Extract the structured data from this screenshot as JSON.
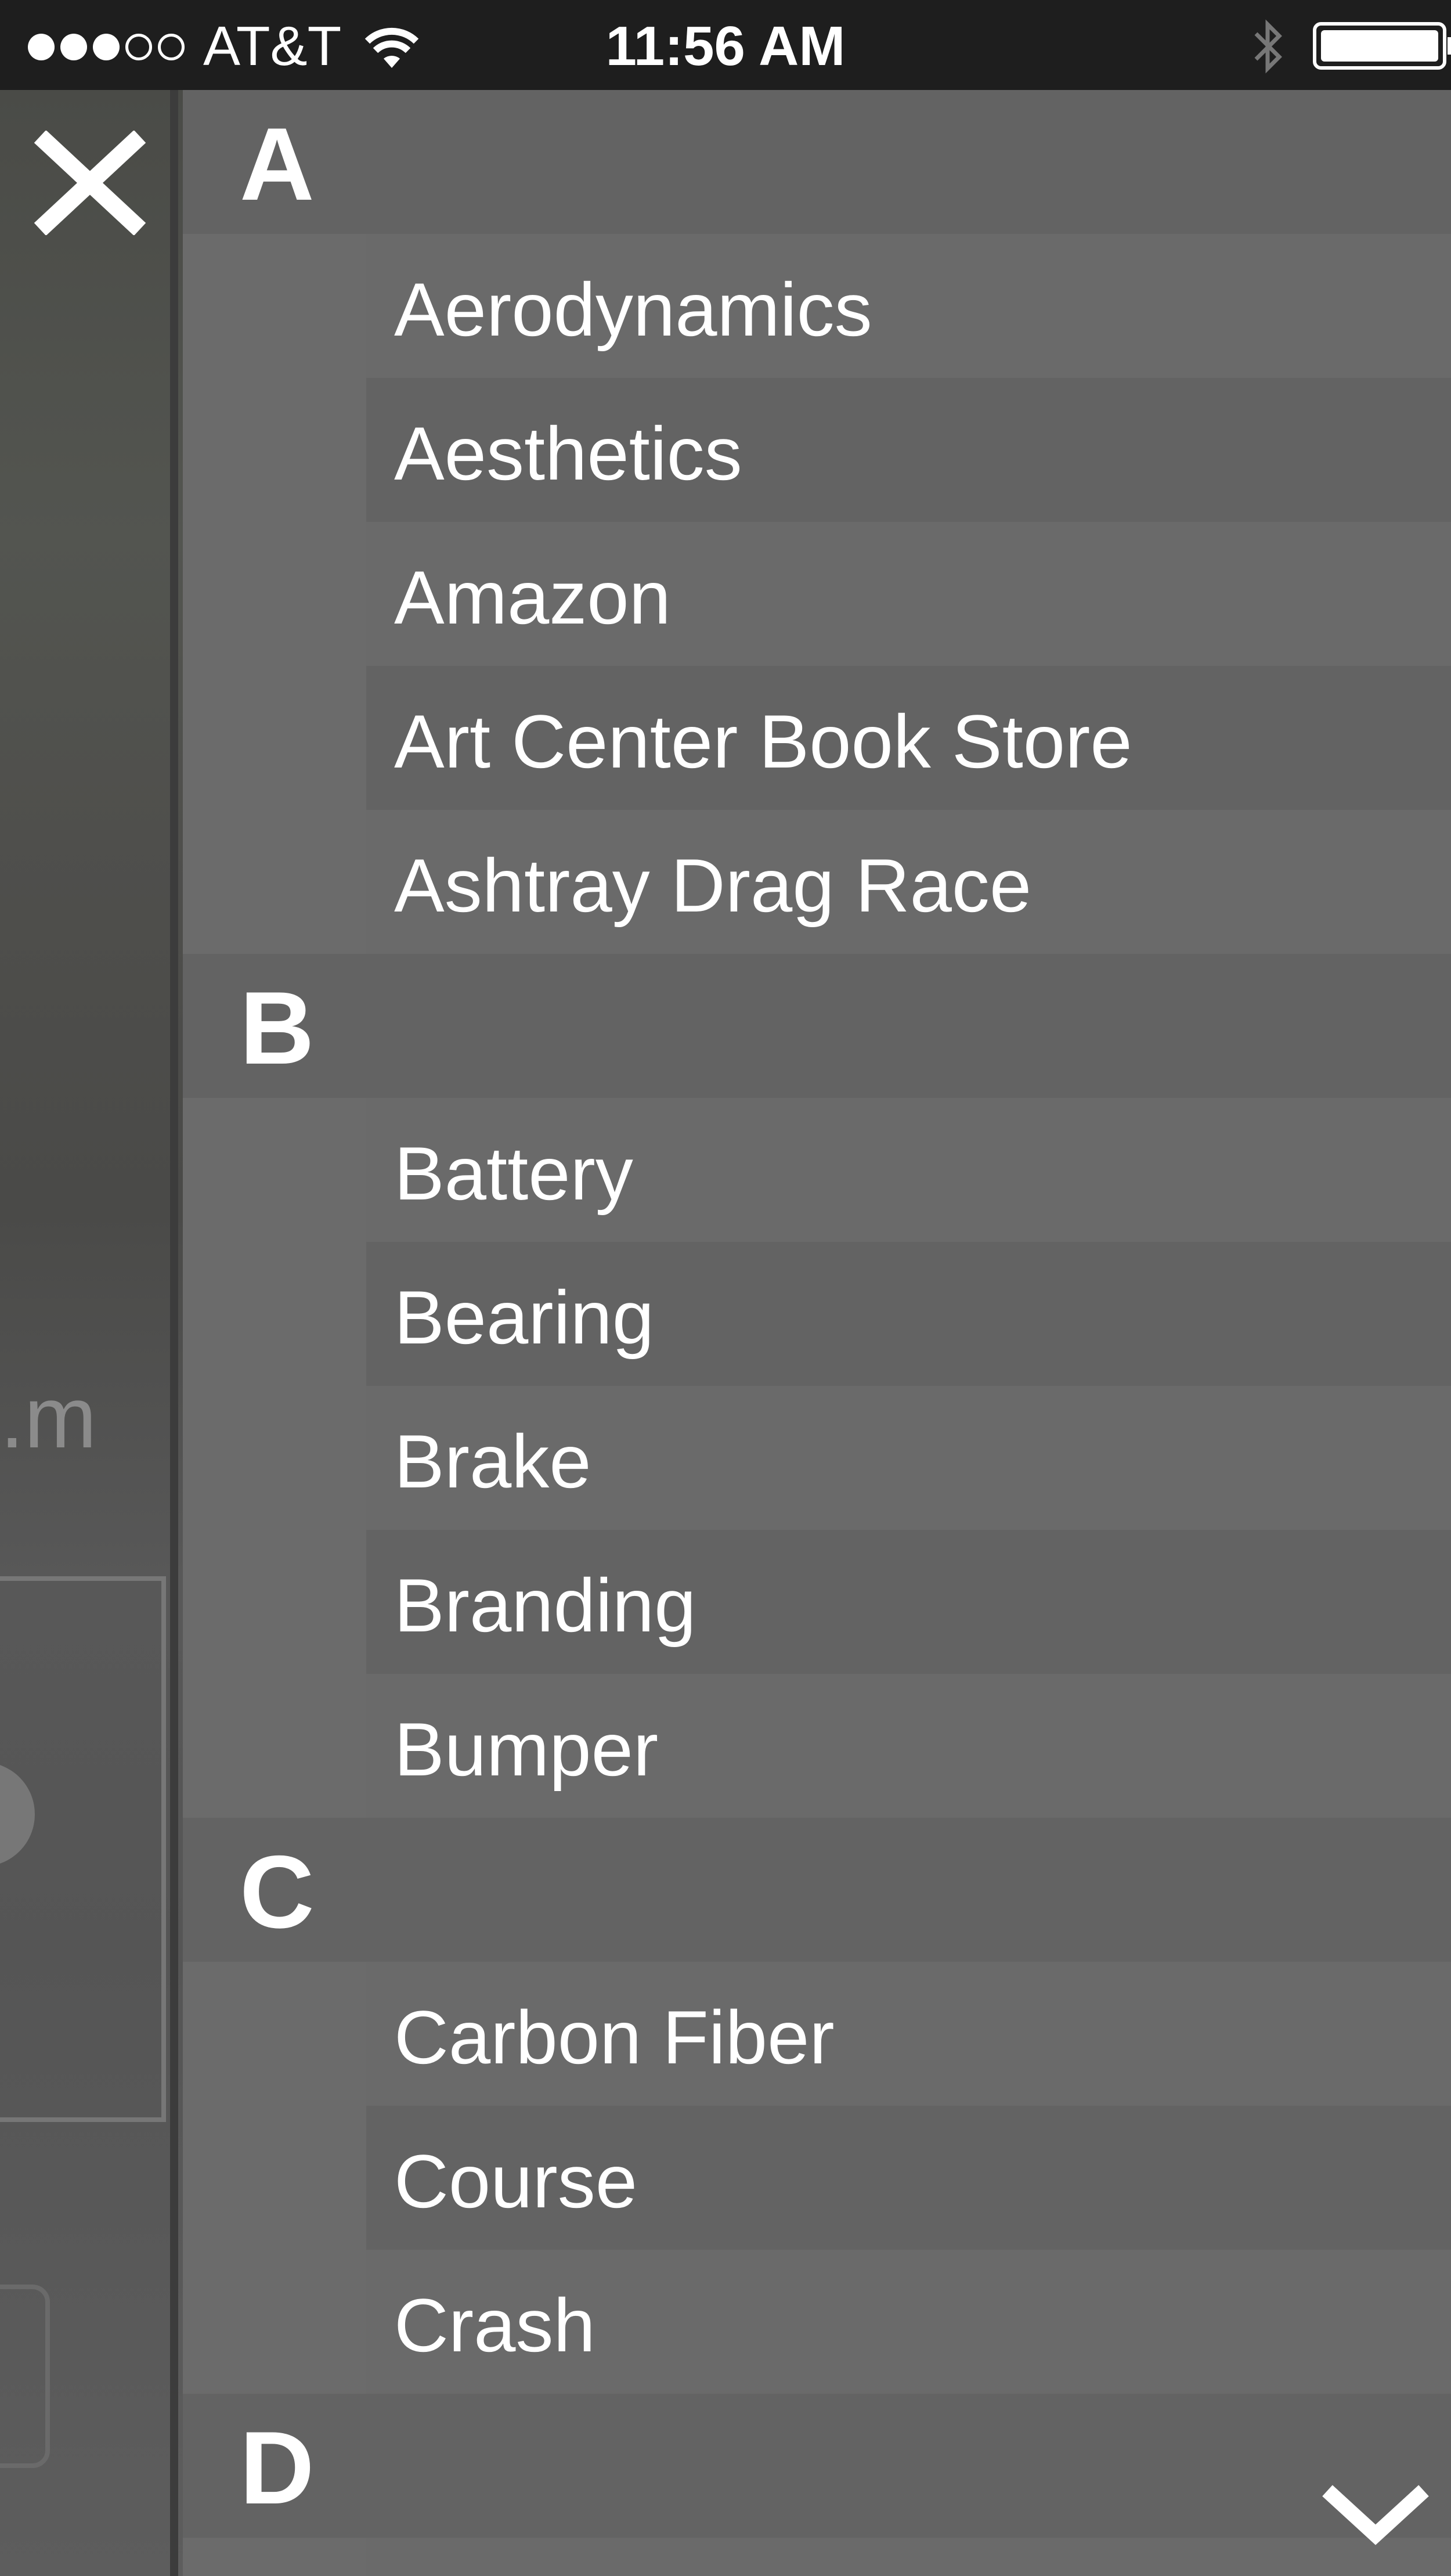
{
  "status_bar": {
    "carrier": "AT&T",
    "time": "11:56 AM",
    "signal_bars_filled": 3,
    "signal_bars_total": 5,
    "battery_level": "full"
  },
  "background": {
    "partial_text": ".m"
  },
  "index": {
    "sections": [
      {
        "letter": "A",
        "items": [
          "Aerodynamics",
          "Aesthetics",
          "Amazon",
          "Art Center Book Store",
          "Ashtray Drag Race"
        ]
      },
      {
        "letter": "B",
        "items": [
          "Battery",
          "Bearing",
          "Brake",
          "Branding",
          "Bumper"
        ]
      },
      {
        "letter": "C",
        "items": [
          "Carbon Fiber",
          "Course",
          "Crash"
        ]
      },
      {
        "letter": "D",
        "items": []
      }
    ]
  },
  "icons": {
    "close": "close-icon",
    "scroll_down": "chevron-down-icon",
    "wifi": "wifi-icon",
    "bluetooth": "bluetooth-icon",
    "battery": "battery-icon"
  }
}
